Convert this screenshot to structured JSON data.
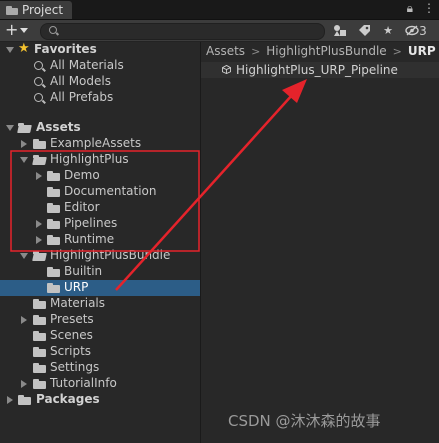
{
  "window": {
    "tab_title": "Project",
    "hidden_count": "3"
  },
  "favorites": {
    "title": "Favorites",
    "items": [
      "All Materials",
      "All Models",
      "All Prefabs"
    ]
  },
  "tree": {
    "assets": "Assets",
    "example_assets": "ExampleAssets",
    "highlightplus": "HighlightPlus",
    "hp_children": [
      "Demo",
      "Documentation",
      "Editor",
      "Pipelines",
      "Runtime"
    ],
    "bundle": "HighlightPlusBundle",
    "bundle_children": [
      "Builtin",
      "URP"
    ],
    "assets_children": [
      "Materials",
      "Presets",
      "Scenes",
      "Scripts",
      "Settings",
      "TutorialInfo"
    ],
    "packages": "Packages"
  },
  "breadcrumb": [
    "Assets",
    "HighlightPlusBundle",
    "URP"
  ],
  "file": {
    "name": "HighlightPlus_URP_Pipeline"
  },
  "annotations": {
    "box_color": "#e5232b",
    "arrow_color": "#e5232b",
    "watermark": "CSDN @沐沐森的故事"
  },
  "icons": {
    "create": "plus-icon",
    "search": "search-icon",
    "scene-filter": "scene-filter-icon",
    "label-filter": "label-icon",
    "favorite-filter": "star-icon",
    "visibility": "eye-slash-icon",
    "lock": "lock-icon",
    "menu": "kebab-menu-icon"
  }
}
